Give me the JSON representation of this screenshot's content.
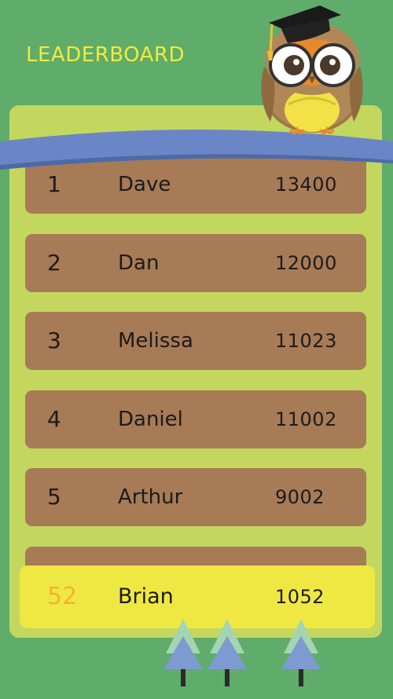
{
  "header": {
    "title": "LEADERBOARD"
  },
  "leaderboard": {
    "rows": [
      {
        "rank": "1",
        "name": "Dave",
        "score": "13400"
      },
      {
        "rank": "2",
        "name": "Dan",
        "score": "12000"
      },
      {
        "rank": "3",
        "name": "Melissa",
        "score": "11023"
      },
      {
        "rank": "4",
        "name": "Daniel",
        "score": "11002"
      },
      {
        "rank": "5",
        "name": "Arthur",
        "score": "9002"
      }
    ],
    "current_user": {
      "rank": "52",
      "name": "Brian",
      "score": "1052"
    }
  },
  "colors": {
    "background": "#5fac6b",
    "board": "#c3d75e",
    "row": "#a67b56",
    "highlight_row": "#f0e842",
    "title": "#f2ea3c",
    "highlight_rank": "#f4b233",
    "branch": "#6a86c6"
  },
  "icons": [
    "owl-mascot-icon",
    "graduation-cap-icon",
    "pine-tree-icon"
  ]
}
